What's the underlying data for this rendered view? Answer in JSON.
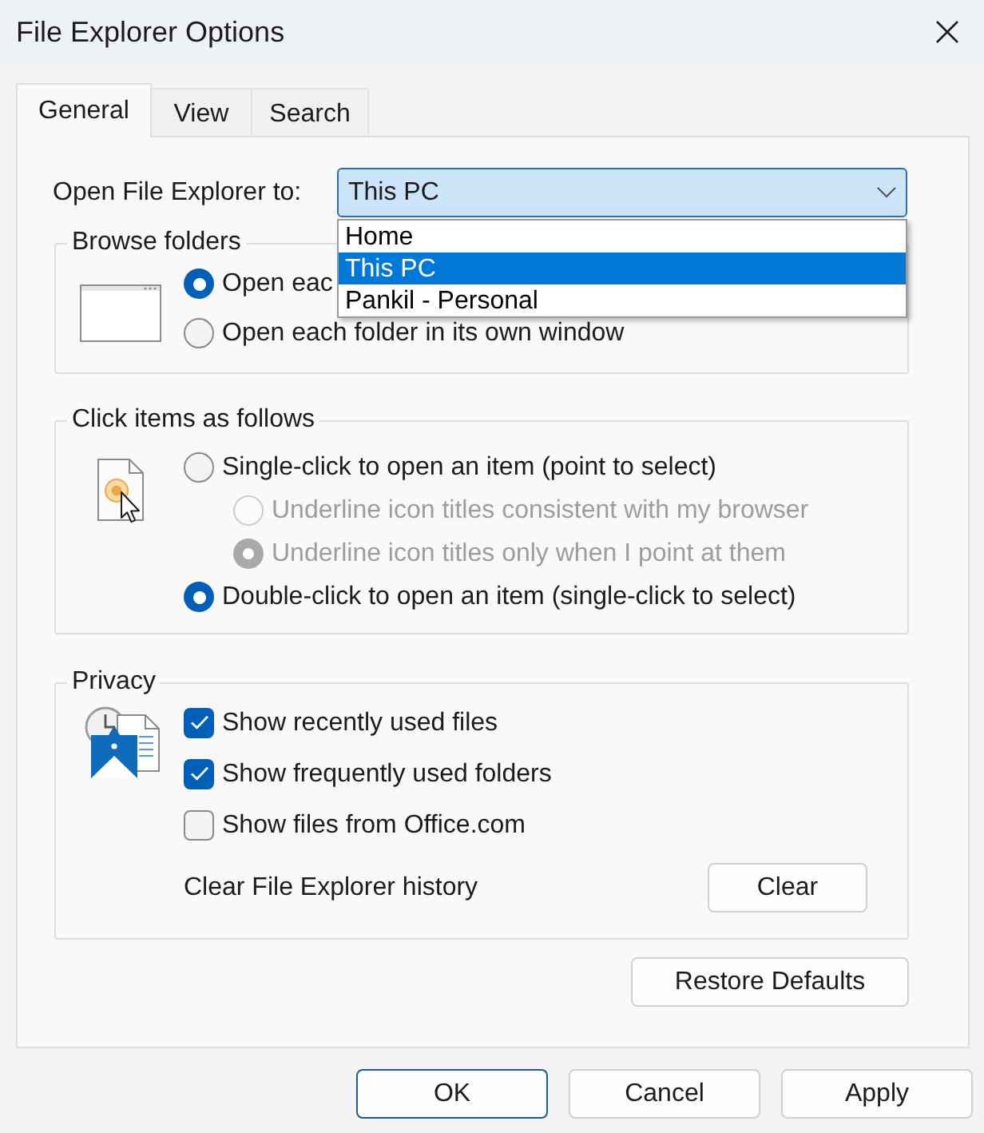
{
  "window": {
    "title": "File Explorer Options"
  },
  "tabs": [
    {
      "label": "General",
      "selected": true
    },
    {
      "label": "View",
      "selected": false
    },
    {
      "label": "Search",
      "selected": false
    }
  ],
  "open_to": {
    "label": "Open File Explorer to:",
    "value": "This PC",
    "expanded": true,
    "options": [
      {
        "label": "Home",
        "selected": false
      },
      {
        "label": "This PC",
        "selected": true
      },
      {
        "label": "Pankil - Personal",
        "selected": false
      }
    ]
  },
  "browse_folders": {
    "title": "Browse folders",
    "options": [
      {
        "label": "Open eac",
        "selected": true,
        "disabled": false
      },
      {
        "label": "Open each folder in its own window",
        "selected": false,
        "disabled": false
      }
    ]
  },
  "click_items": {
    "title": "Click items as follows",
    "options": [
      {
        "label": "Single-click to open an item (point to select)",
        "selected": false,
        "disabled": false,
        "children": [
          {
            "label": "Underline icon titles consistent with my browser",
            "selected": false,
            "disabled": true
          },
          {
            "label": "Underline icon titles only when I point at them",
            "selected": true,
            "disabled": true
          }
        ]
      },
      {
        "label": "Double-click to open an item (single-click to select)",
        "selected": true,
        "disabled": false
      }
    ]
  },
  "privacy": {
    "title": "Privacy",
    "options": [
      {
        "label": "Show recently used files",
        "checked": true
      },
      {
        "label": "Show frequently used folders",
        "checked": true
      },
      {
        "label": "Show files from Office.com",
        "checked": false
      }
    ],
    "history_label": "Clear File Explorer history",
    "clear_button": "Clear"
  },
  "restore_defaults_button": "Restore Defaults",
  "buttons": [
    {
      "label": "OK",
      "focused": true
    },
    {
      "label": "Cancel",
      "focused": false
    },
    {
      "label": "Apply",
      "focused": false
    }
  ]
}
